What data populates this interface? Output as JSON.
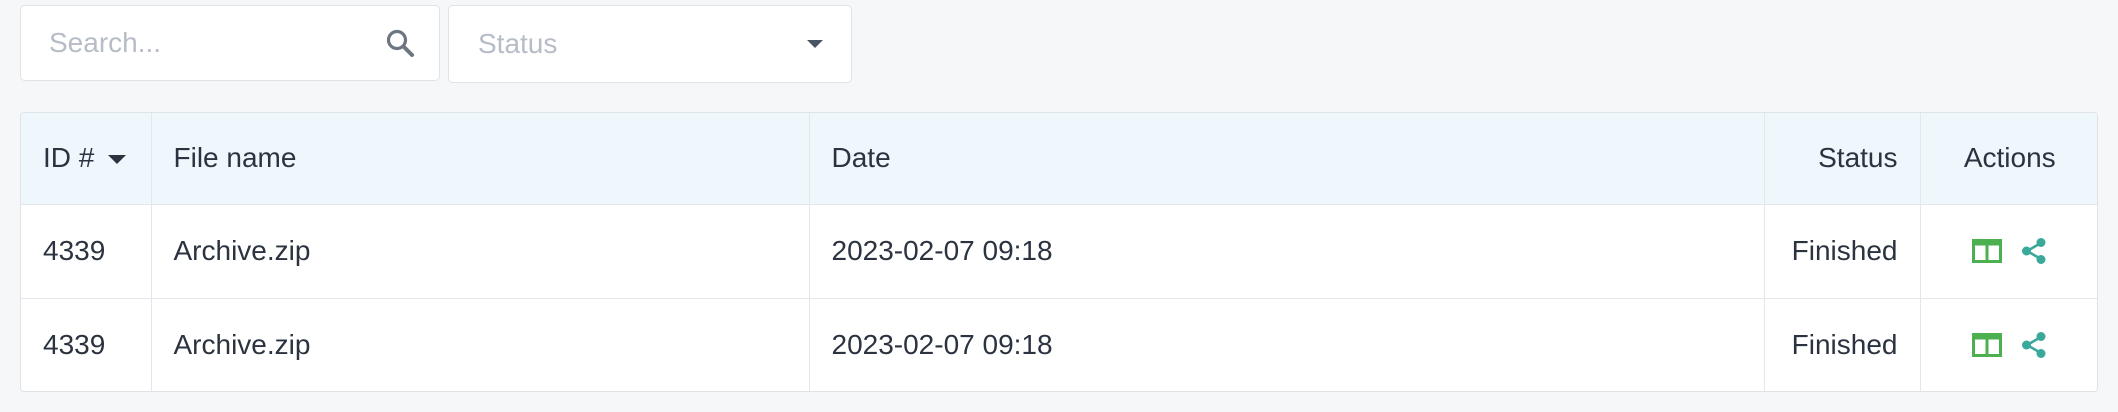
{
  "filters": {
    "search_placeholder": "Search...",
    "search_icon": "search-icon",
    "status_placeholder": "Status",
    "status_icon": "caret-down-icon"
  },
  "table": {
    "columns": [
      "ID #",
      "File name",
      "Date",
      "Status",
      "Actions"
    ],
    "sorted_column_icon": "sort-desc-icon",
    "rows": [
      {
        "id": "4339",
        "file_name": "Archive.zip",
        "date": "2023-02-07 09:18",
        "status": "Finished"
      },
      {
        "id": "4339",
        "file_name": "Archive.zip",
        "date": "2023-02-07 09:18",
        "status": "Finished"
      }
    ],
    "action_icons": [
      "view-columns-icon",
      "share-icon"
    ]
  },
  "colors": {
    "view_icon": "#4caf50",
    "share_icon": "#3aa89a",
    "header_bg": "#eef7fb",
    "page_bg": "#f6f7f9"
  }
}
